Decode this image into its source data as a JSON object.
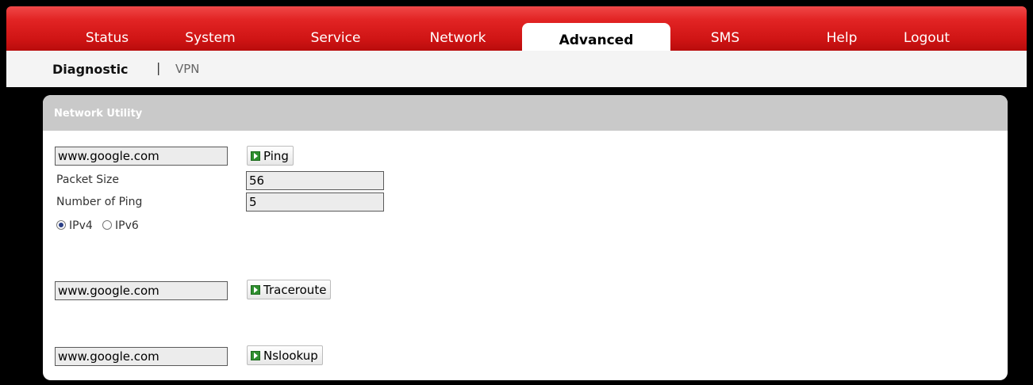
{
  "nav": {
    "tabs": [
      "Status",
      "System",
      "Service",
      "Network",
      "Advanced",
      "SMS",
      "Help",
      "Logout"
    ],
    "active": "Advanced"
  },
  "subnav": {
    "items": [
      "Diagnostic",
      "VPN"
    ],
    "separator": "|",
    "active": "Diagnostic"
  },
  "panel": {
    "title": "Network Utility",
    "ping": {
      "host": "www.google.com",
      "button": "Ping",
      "packet_size_label": "Packet Size",
      "packet_size": "56",
      "count_label": "Number of Ping",
      "count": "5",
      "ipv4_label": "IPv4",
      "ipv6_label": "IPv6",
      "selected": "IPv4"
    },
    "traceroute": {
      "host": "www.google.com",
      "button": "Traceroute"
    },
    "nslookup": {
      "host": "www.google.com",
      "button": "Nslookup"
    }
  },
  "colors": {
    "nav_red": "#e22424",
    "panel_header": "#c9c9c9",
    "background": "#000000"
  }
}
